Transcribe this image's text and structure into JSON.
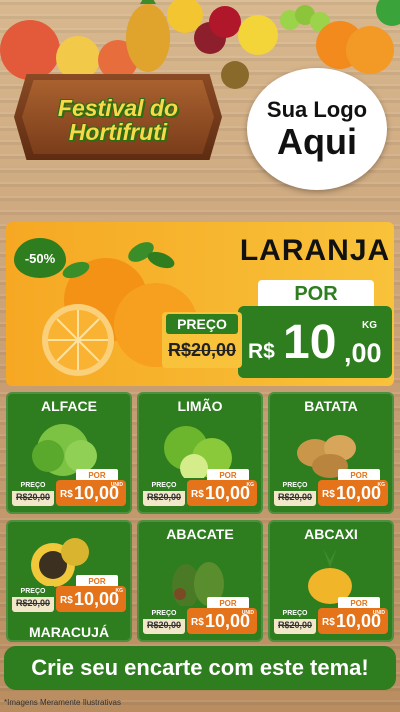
{
  "header": {
    "festival_title_line1": "Festival do",
    "festival_title_line2": "Hortifruti",
    "logo_line1": "Sua Logo",
    "logo_line2": "Aqui"
  },
  "hero": {
    "discount": "-50%",
    "product": "LARANJA",
    "por": "POR",
    "old_label": "PREÇO",
    "old_price": "R$20,00",
    "currency": "R$",
    "price_int": "10",
    "price_dec": ",00",
    "unit": "KG"
  },
  "products": [
    {
      "name": "ALFACE",
      "por": "POR",
      "old_label": "PREÇO",
      "old_price": "R$20,00",
      "currency": "R$",
      "price": "10,00",
      "unit": "UNID"
    },
    {
      "name": "LIMÃO",
      "por": "POR",
      "old_label": "PREÇO",
      "old_price": "R$20,00",
      "currency": "R$",
      "price": "10,00",
      "unit": "KG"
    },
    {
      "name": "BATATA",
      "por": "POR",
      "old_label": "PREÇO",
      "old_price": "R$20,00",
      "currency": "R$",
      "price": "10,00",
      "unit": "KG"
    },
    {
      "name": "MARACUJÁ",
      "por": "POR",
      "old_label": "PREÇO",
      "old_price": "R$20,00",
      "currency": "R$",
      "price": "10,00",
      "unit": "KG"
    },
    {
      "name": "ABACATE",
      "por": "POR",
      "old_label": "PREÇO",
      "old_price": "R$20,00",
      "currency": "R$",
      "price": "10,00",
      "unit": "UNID"
    },
    {
      "name": "ABCAXI",
      "por": "POR",
      "old_label": "PREÇO",
      "old_price": "R$20,00",
      "currency": "R$",
      "price": "10,00",
      "unit": "UNID"
    }
  ],
  "cta": "Crie seu encarte com este tema!",
  "disclaimer": "*Imagens Meramente Ilustrativas",
  "colors": {
    "green": "#2e7d1e",
    "orange": "#e4731a",
    "yellow": "#f8c23a"
  }
}
